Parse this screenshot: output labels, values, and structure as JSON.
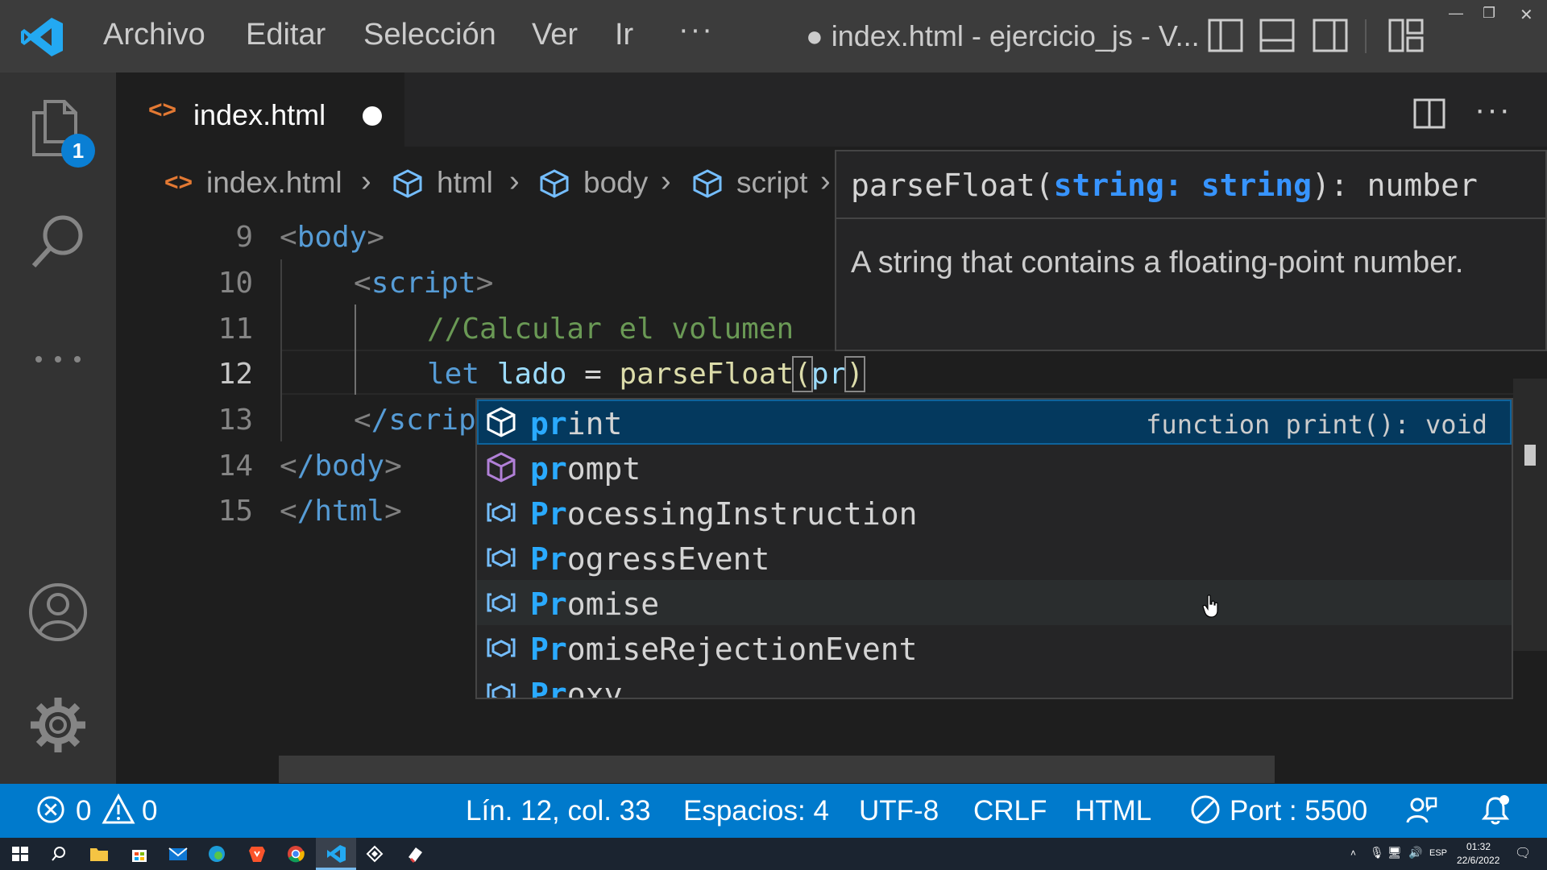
{
  "titlebar": {
    "menu": [
      "Archivo",
      "Editar",
      "Selección",
      "Ver",
      "Ir",
      "···"
    ],
    "window_title": "● index.html - ejercicio_js - V..."
  },
  "activity_bar": {
    "explorer_badge": "1"
  },
  "tabs": [
    {
      "label": "index.html",
      "icon": "html-file-icon",
      "dirty": true,
      "active": true
    }
  ],
  "breadcrumb": [
    "index.html",
    "html",
    "body",
    "script"
  ],
  "editor": {
    "lines": [
      {
        "num": "9"
      },
      {
        "num": "10"
      },
      {
        "num": "11"
      },
      {
        "num": "12"
      },
      {
        "num": "13"
      },
      {
        "num": "14"
      },
      {
        "num": "15"
      }
    ],
    "code": {
      "l9_tag": "body",
      "l10_tag": "script",
      "l11_comment": "//Calcular el volumen",
      "l12_kw": "let",
      "l12_var": "lado",
      "l12_eq": " = ",
      "l12_fn": "parseFloat",
      "l12_arg": "pr",
      "l13_tag": "/scrip",
      "l14_tag": "/body",
      "l15_tag": "/html"
    }
  },
  "hover": {
    "fn_name": "parseFloat(",
    "param_name": "string",
    "colon": ": ",
    "param_type": "string",
    "ret": "): number",
    "doc": "A string that contains a floating-point number."
  },
  "suggestions": [
    {
      "match": "pr",
      "rest": "int",
      "kind": "function",
      "detail": "function print(): void",
      "selected": true
    },
    {
      "match": "pr",
      "rest": "ompt",
      "kind": "function",
      "detail": ""
    },
    {
      "match": "Pr",
      "rest": "ocessingInstruction",
      "kind": "variable",
      "detail": ""
    },
    {
      "match": "Pr",
      "rest": "ogressEvent",
      "kind": "variable",
      "detail": ""
    },
    {
      "match": "Pr",
      "rest": "omise",
      "kind": "variable",
      "detail": ""
    },
    {
      "match": "Pr",
      "rest": "omiseRejectionEvent",
      "kind": "variable",
      "detail": ""
    },
    {
      "match": "Pr",
      "rest": "oxy",
      "kind": "variable",
      "detail": ""
    }
  ],
  "statusbar": {
    "errors": "0",
    "warnings": "0",
    "position": "Lín. 12, col. 33",
    "spaces": "Espacios: 4",
    "encoding": "UTF-8",
    "eol": "CRLF",
    "language": "HTML",
    "port": "Port : 5500"
  },
  "taskbar": {
    "lang": "ESP",
    "time": "01:32",
    "date": "22/6/2022"
  },
  "colors": {
    "accent": "#007acc",
    "selection": "#04395e",
    "match": "#2aaaff",
    "tag": "#569cd6",
    "comment": "#6a9955"
  }
}
